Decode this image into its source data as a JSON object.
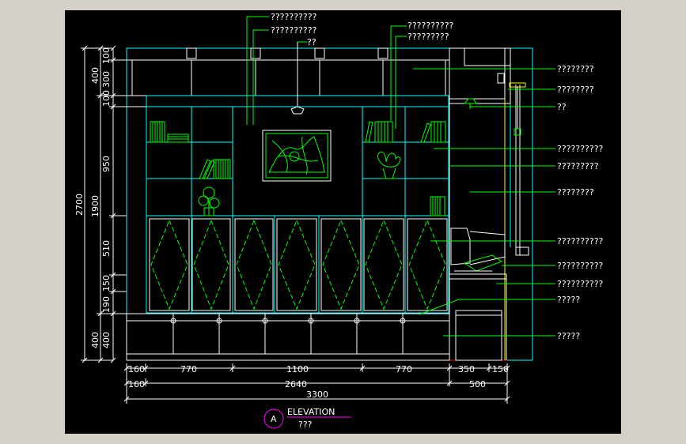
{
  "colors": {
    "background": "#000000",
    "frame": "#ffffff",
    "cabinet": "#00ffff",
    "furniture": "#00ff00",
    "leader": "#00ff00",
    "text": "#ffffff",
    "dimension": "#ffffff",
    "accent": "#ff00ff",
    "ground": "#ff0000"
  },
  "title": {
    "marker": "A",
    "label": "ELEVATION",
    "sublabel": "???"
  },
  "left_dimensions": {
    "outer_total": "2700",
    "middle": [
      "400",
      "1900",
      "400"
    ],
    "inner": [
      "100",
      "300",
      "100",
      "950",
      "510",
      "150",
      "190",
      "400"
    ]
  },
  "bottom_dimensions": {
    "row1": [
      "160",
      "770",
      "1100",
      "770",
      "350",
      "150"
    ],
    "row2": [
      "160",
      "2640",
      "500"
    ],
    "row3": [
      "3300"
    ]
  },
  "annotations_top": [
    "??????????",
    "??????????",
    "??",
    "??????????",
    "?????????"
  ],
  "annotations_right": [
    "????????",
    "????????",
    "??",
    "??????????",
    "?????????",
    "????????",
    "??????????",
    "??????????",
    "??????????",
    "?????",
    "?????"
  ]
}
